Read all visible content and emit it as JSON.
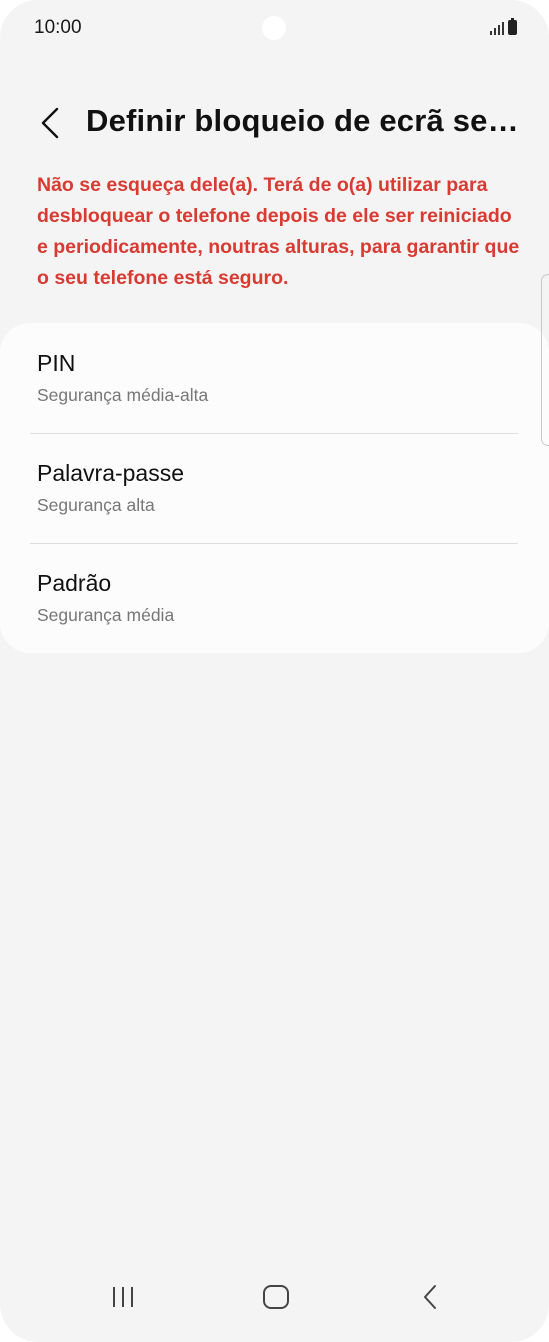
{
  "status_bar": {
    "time": "10:00"
  },
  "header": {
    "back_icon": "chevron-left-icon",
    "title": "Definir bloqueio de ecrã seg..."
  },
  "warning": {
    "text": "Não se esqueça dele(a). Terá de o(a) utilizar para desbloquear o telefone depois de ele ser reiniciado e periodicamente, noutras alturas, para garantir que o seu telefone está seguro.",
    "color": "#d93a32"
  },
  "options": [
    {
      "title": "PIN",
      "subtitle": "Segurança média-alta"
    },
    {
      "title": "Palavra-passe",
      "subtitle": "Segurança alta"
    },
    {
      "title": "Padrão",
      "subtitle": "Segurança média"
    }
  ],
  "nav_bar": {
    "recents_icon": "recents-icon",
    "home_icon": "home-icon",
    "back_icon": "back-icon"
  }
}
